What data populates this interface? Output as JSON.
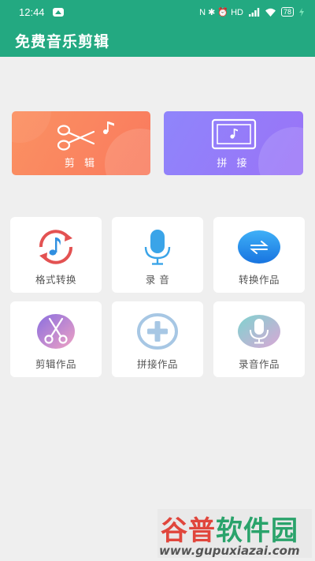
{
  "status_bar": {
    "time": "12:44",
    "indicators": "N ✱ ⏰ HD",
    "battery": "78",
    "color": "#23a981"
  },
  "app_bar": {
    "title": "免费音乐剪辑",
    "color": "#23a981"
  },
  "big_cards": [
    {
      "label": "剪 辑",
      "icon": "scissors-music-icon",
      "color": "#fb8660"
    },
    {
      "label": "拼 接",
      "icon": "screen-music-icon",
      "color": "#9a7cf9"
    }
  ],
  "tiles": [
    {
      "label": "格式转换",
      "icon": "format-convert-icon"
    },
    {
      "label": "录 音",
      "icon": "microphone-icon"
    },
    {
      "label": "转换作品",
      "icon": "converted-works-icon"
    },
    {
      "label": "剪辑作品",
      "icon": "cut-works-icon"
    },
    {
      "label": "拼接作品",
      "icon": "join-works-icon"
    },
    {
      "label": "录音作品",
      "icon": "recording-works-icon"
    }
  ],
  "watermark": {
    "brand_part1": "谷普",
    "brand_part2": "软件园",
    "url": "www.gupuxiazai.com"
  }
}
